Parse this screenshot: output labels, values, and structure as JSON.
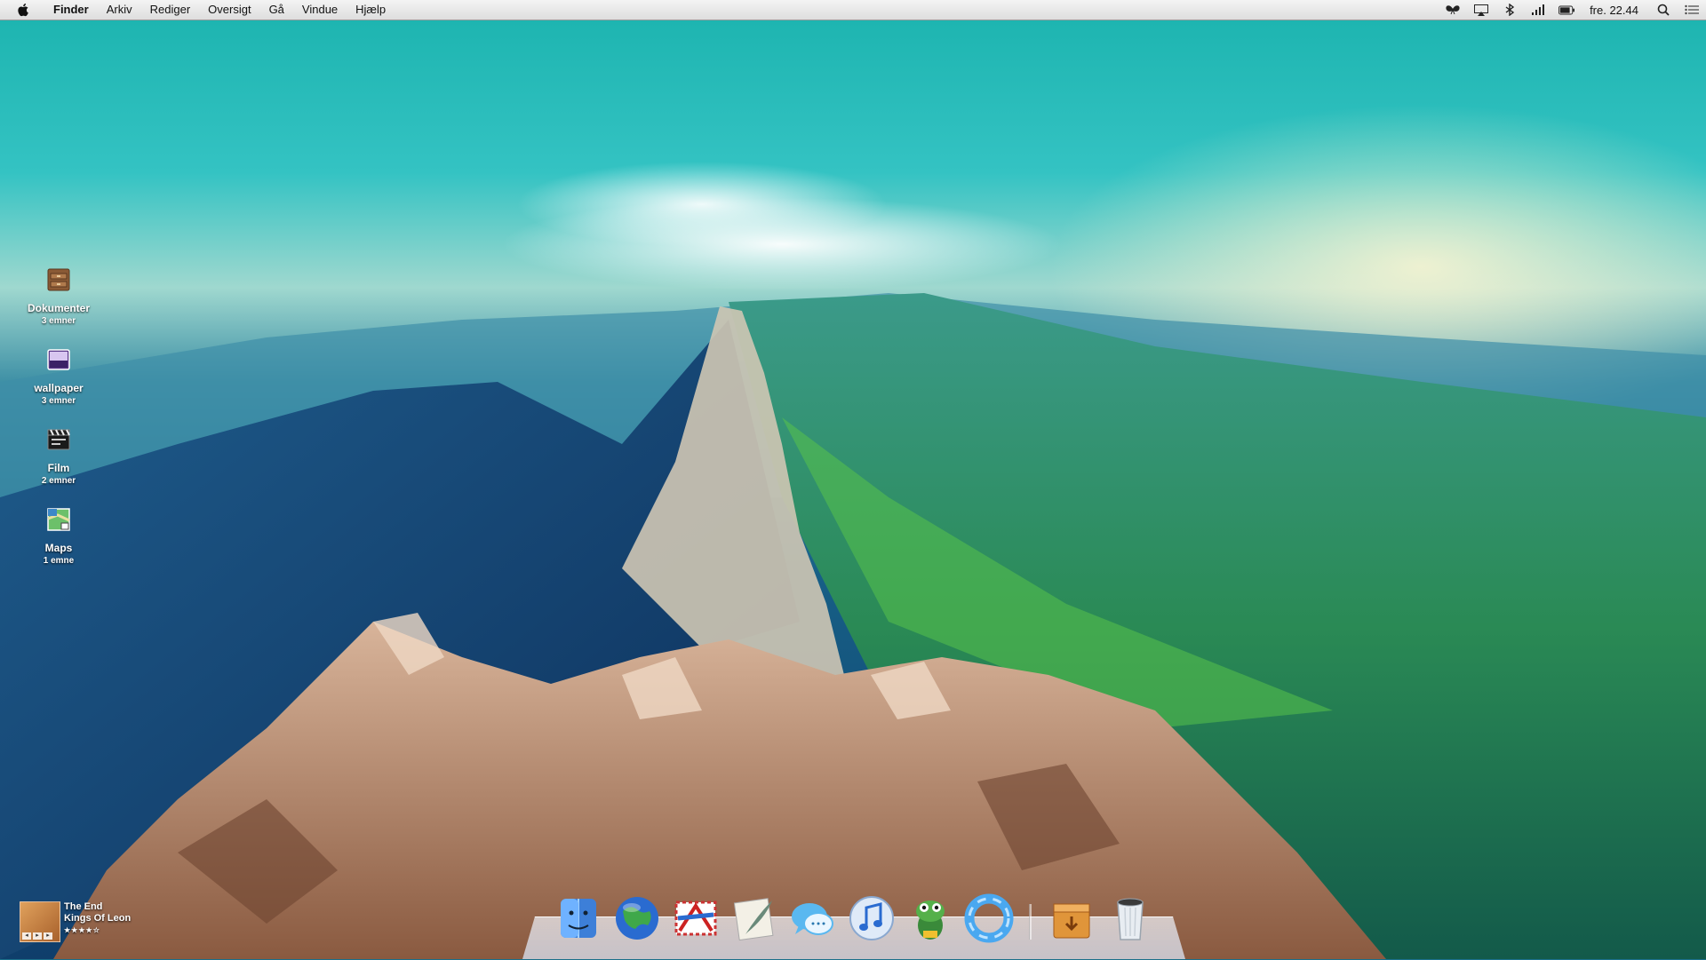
{
  "menubar": {
    "app_name": "Finder",
    "items": [
      "Arkiv",
      "Rediger",
      "Oversigt",
      "Gå",
      "Vindue",
      "Hjælp"
    ],
    "status_icons": [
      "butterfly-icon",
      "airplay-icon",
      "bluetooth-icon",
      "signal-bars-icon",
      "battery-icon"
    ],
    "clock": "fre. 22.44",
    "right_icons": [
      "spotlight-icon",
      "notification-list-icon"
    ]
  },
  "desktop": {
    "icons": [
      {
        "name": "Dokumenter",
        "count": "3 emner",
        "icon": "drawer-folder-icon"
      },
      {
        "name": "wallpaper",
        "count": "3 emner",
        "icon": "image-folder-icon"
      },
      {
        "name": "Film",
        "count": "2 emner",
        "icon": "film-clapper-icon"
      },
      {
        "name": "Maps",
        "count": "1 emne",
        "icon": "map-icon"
      }
    ]
  },
  "now_playing": {
    "title": "The End",
    "artist": "Kings Of Leon",
    "stars": "★★★★☆"
  },
  "dock": {
    "apps": [
      "finder-icon",
      "globe-browser-icon",
      "mail-stamp-icon",
      "quill-writer-icon",
      "messages-icon",
      "itunes-icon",
      "adium-frog-icon",
      "blue-ring-icon"
    ],
    "stacks": [
      "downloads-box-icon",
      "trash-icon"
    ]
  }
}
